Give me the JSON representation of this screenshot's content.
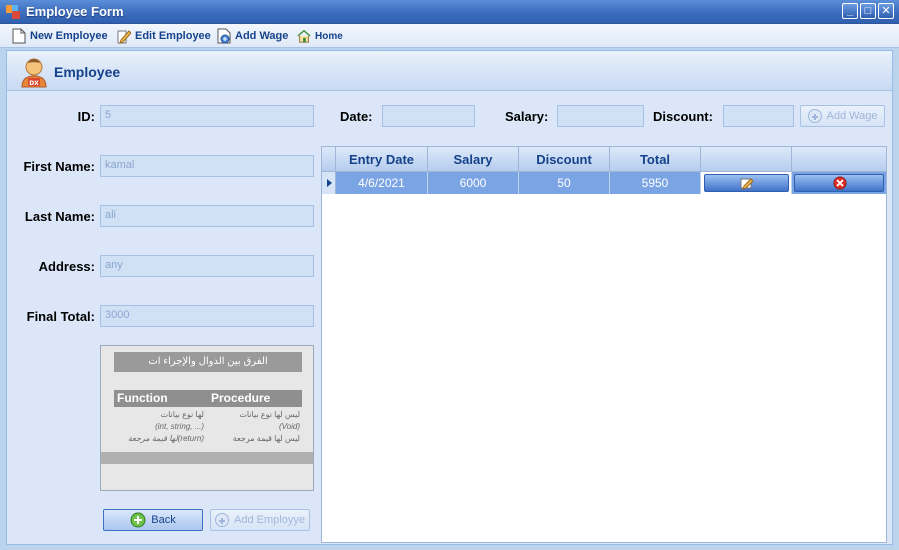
{
  "window": {
    "title": "Employee Form",
    "controls": [
      "minimize-icon",
      "maximize-icon",
      "close-icon"
    ]
  },
  "toolbar": {
    "items": [
      {
        "label": "New Employee",
        "icon": "new-document-icon"
      },
      {
        "label": "Edit Employee",
        "icon": "edit-pencil-icon"
      },
      {
        "label": "Add Wage",
        "icon": "add-document-icon"
      },
      {
        "label": "Home",
        "icon": "home-icon"
      }
    ]
  },
  "panel": {
    "title": "Employee",
    "icon": "employee-avatar-icon",
    "badge": "DX"
  },
  "form": {
    "id_label": "ID:",
    "id_value": "5",
    "first_name_label": "First Name:",
    "first_name_value": "kamal",
    "last_name_label": "Last Name:",
    "last_name_value": "ali",
    "address_label": "Address:",
    "address_value": "any",
    "final_total_label": "Final Total:",
    "final_total_value": "3000",
    "date_label": "Date:",
    "date_value": "",
    "salary_label": "Salary:",
    "salary_value": "",
    "discount_label": "Discount:",
    "discount_value": "",
    "add_wage_button": "Add Wage",
    "back_button": "Back",
    "add_employee_button": "Add Employye"
  },
  "grid": {
    "columns": [
      "Entry Date",
      "Salary",
      "Discount",
      "Total",
      "",
      ""
    ],
    "rows": [
      {
        "entry_date": "4/6/2021",
        "salary": "6000",
        "discount": "50",
        "total": "5950"
      }
    ]
  },
  "thumbnail": {
    "title": "الفرق بين الدوال والإجراء ات",
    "col1_header": "Function",
    "col2_header": "Procedure",
    "rows": [
      [
        "لها نوع بيانات",
        "ليس لها نوع بيانات"
      ],
      [
        "(int, string, ...)",
        "(Void)"
      ],
      [
        "لها قيمة مرجعة(return)",
        "ليس لها قيمة مرجعة"
      ]
    ]
  }
}
